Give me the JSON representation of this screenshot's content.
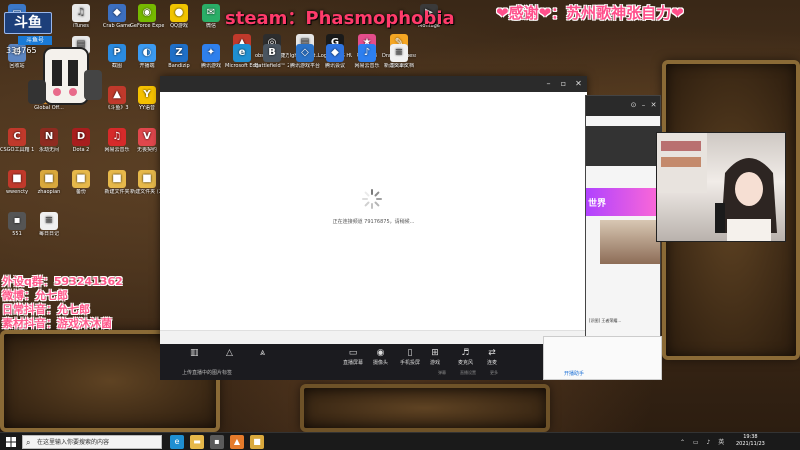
{
  "overlay": {
    "steam_title": "steam：Phasmophobia",
    "thanks": "❤感谢❤：苏州歌神张自力❤",
    "info_lines": [
      "外设q群：593241362",
      "微博：允七郎",
      "日常抖音：允七郎",
      "素材抖音：游戏沐沐菌"
    ],
    "logo_text": "斗鱼",
    "logo_sub": "斗鱼号",
    "logo_id": "334765"
  },
  "desktop_icons": [
    {
      "label": "此电脑",
      "icon": "computer-icon",
      "color": "#3b78c8",
      "glyph": "▭"
    },
    {
      "label": "iTunes",
      "icon": "itunes-icon",
      "color": "#e8e8e8",
      "glyph": "♫"
    },
    {
      "label": "Crab Game",
      "icon": "crab-game-icon",
      "color": "#3c6fbf",
      "glyph": "◆"
    },
    {
      "label": "GeForce Experience",
      "icon": "geforce-icon",
      "color": "#76b900",
      "glyph": "◉"
    },
    {
      "label": "QQ游戏",
      "icon": "qq-game-icon",
      "color": "#f0c400",
      "glyph": "●"
    },
    {
      "label": "微信",
      "icon": "wechat-icon",
      "color": "#2aae67",
      "glyph": "✉"
    },
    {
      "label": "",
      "icon": "red-app-icon",
      "color": "#c0392b",
      "glyph": "▲"
    },
    {
      "label": "obs64 - 快捷方式",
      "icon": "obs-icon",
      "color": "#2d2d2d",
      "glyph": "◎"
    },
    {
      "label": "lghub_inst...",
      "icon": "lghub-installer-icon",
      "color": "#e6e6e6",
      "glyph": "▤"
    },
    {
      "label": "Logitech G HUB",
      "icon": "logitech-icon",
      "color": "#1a1a1a",
      "glyph": "G"
    },
    {
      "label": "哔哩服饰",
      "icon": "bili-store-icon",
      "color": "#e44d8b",
      "glyph": "★"
    },
    {
      "label": "Draw & Guess",
      "icon": "draw-guess-icon",
      "color": "#f5a623",
      "glyph": "✎"
    },
    {
      "label": "Montage",
      "icon": "montage-icon",
      "color": "#3a3a3a",
      "glyph": "▶"
    },
    {
      "label": "回收站",
      "icon": "recycle-bin-icon",
      "color": "#5d86c2",
      "glyph": "♻"
    },
    {
      "label": "",
      "icon": "document-icon",
      "color": "#e8e8e8",
      "glyph": "▤"
    },
    {
      "label": "截图",
      "icon": "screenshot-icon",
      "color": "#2b8be0",
      "glyph": "P"
    },
    {
      "label": "开播端",
      "icon": "streamer-app-icon",
      "color": "#3b9af1",
      "glyph": "◐"
    },
    {
      "label": "Bandizip",
      "icon": "bandizip-icon",
      "color": "#1f6fc7",
      "glyph": "Z"
    },
    {
      "label": "腾讯游戏",
      "icon": "tencent-game-icon",
      "color": "#2f80ed",
      "glyph": "✦"
    },
    {
      "label": "Microsoft Edge",
      "icon": "edge-icon",
      "color": "#1f8fd1",
      "glyph": "e"
    },
    {
      "label": "Battlefield™ 2042 Ope...",
      "icon": "battlefield-icon",
      "color": "#4a5560",
      "glyph": "B"
    },
    {
      "label": "腾讯游戏平台",
      "icon": "game-platform-icon",
      "color": "#2a72c7",
      "glyph": "◇"
    },
    {
      "label": "腾讯会议",
      "icon": "meeting-icon",
      "color": "#2f74e0",
      "glyph": "◆"
    },
    {
      "label": "网易云音乐",
      "icon": "music-app-icon",
      "color": "#2d7ff0",
      "glyph": "♪"
    },
    {
      "label": "Steam",
      "icon": "steam-icon",
      "color": "#1b2838",
      "glyph": "S"
    },
    {
      "label": "新建文本文档",
      "icon": "text-file-icon",
      "color": "#f0f0f0",
      "glyph": "≡"
    },
    {
      "label": "Global Off...",
      "icon": "csgo-icon",
      "color": "#d08a2a",
      "glyph": "⊕"
    },
    {
      "label": "《斗鱼》3",
      "icon": "douyu-app-icon",
      "color": "#c0392b",
      "glyph": "▲"
    },
    {
      "label": "YY语音",
      "icon": "yy-icon",
      "color": "#f5c000",
      "glyph": "Y"
    },
    {
      "label": "CSGO工具箱 1.0.3 (1)",
      "icon": "csgo-tool-icon",
      "color": "#c0392b",
      "glyph": "C"
    },
    {
      "label": "永劫无间",
      "icon": "naraka-icon",
      "color": "#8e2b20",
      "glyph": "N"
    },
    {
      "label": "Dota 2",
      "icon": "dota-icon",
      "color": "#a81e1e",
      "glyph": "D"
    },
    {
      "label": "网易云音乐",
      "icon": "netease-icon",
      "color": "#d62a2a",
      "glyph": "♫"
    },
    {
      "label": "无畏契约",
      "icon": "valorant-icon",
      "color": "#e0474c",
      "glyph": "V"
    },
    {
      "label": "wwencty",
      "icon": "folder-user-icon",
      "color": "#c0392b",
      "glyph": "■"
    },
    {
      "label": "zhaopian",
      "icon": "photo-folder-icon",
      "color": "#d9a83c",
      "glyph": "■"
    },
    {
      "label": "备份",
      "icon": "backup-folder-icon",
      "color": "#e6b84a",
      "glyph": "■"
    },
    {
      "label": "新建文件夹",
      "icon": "new-folder-icon",
      "color": "#e6b84a",
      "glyph": "■"
    },
    {
      "label": "新建文件夹 (2)",
      "icon": "new-folder-2-icon",
      "color": "#e6b84a",
      "glyph": "■"
    },
    {
      "label": "551",
      "icon": "file-551-icon",
      "color": "#555",
      "glyph": "▪"
    },
    {
      "label": "每日日记",
      "icon": "diary-icon",
      "color": "#f0f0f0",
      "glyph": "≡"
    }
  ],
  "main_window": {
    "connecting_msg": "正在连接频道 79176875，请稍候..."
  },
  "stream_toolbar": {
    "items": [
      {
        "label": "直播屏幕",
        "icon": "screen-share-icon",
        "glyph": "▭"
      },
      {
        "label": "摄像头",
        "icon": "camera-icon",
        "glyph": "◉"
      },
      {
        "label": "手机投屏",
        "icon": "phone-cast-icon",
        "glyph": "▯"
      },
      {
        "label": "游戏",
        "icon": "game-icon",
        "glyph": "⊞"
      },
      {
        "label": "麦克风",
        "icon": "microphone-icon",
        "glyph": "♬"
      },
      {
        "label": "连麦",
        "icon": "link-mic-icon",
        "glyph": "⇄"
      }
    ],
    "hint": "上传直播中的图片标签",
    "right_labels": [
      "弹幕",
      "直播设置",
      "更多"
    ]
  },
  "side_window": {
    "banner_text": "世界",
    "chat_line": "[识图] 王者荣耀...",
    "bottom_link": "开播助手"
  },
  "taskbar": {
    "search_placeholder": "在这里输入你要搜索的内容",
    "time": "19:38",
    "date": "2021/11/23"
  }
}
